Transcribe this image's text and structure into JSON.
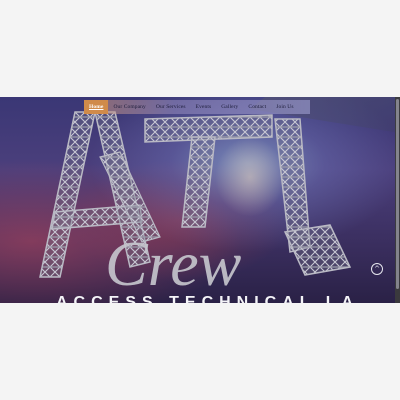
{
  "nav": {
    "items": [
      {
        "label": "Home",
        "active": true
      },
      {
        "label": "Our Company",
        "active": false
      },
      {
        "label": "Our Services",
        "active": false
      },
      {
        "label": "Events",
        "active": false
      },
      {
        "label": "Gallery",
        "active": false
      },
      {
        "label": "Contact",
        "active": false
      },
      {
        "label": "Join Us",
        "active": false
      }
    ]
  },
  "logo": {
    "letters": "ATL",
    "script_word": "Crew"
  },
  "hero": {
    "tagline": "ACCESS TECHNICAL LABOR"
  },
  "icons": {
    "scroll_up": "chevron-up-icon"
  },
  "colors": {
    "nav_active": "#d08b4a",
    "hero_base": "#3b2f60",
    "truss": "#b9b9c4"
  }
}
